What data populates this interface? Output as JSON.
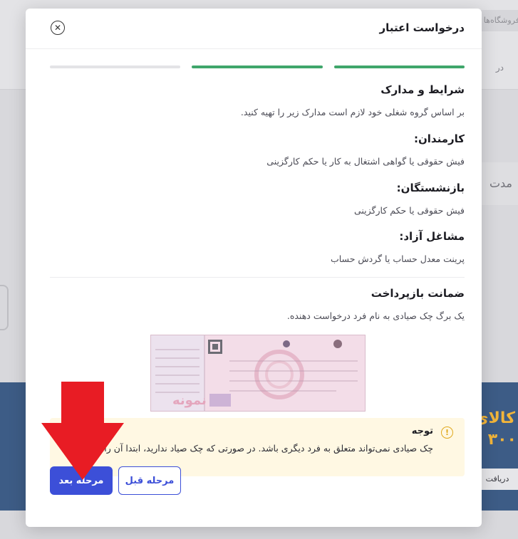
{
  "background": {
    "search_placeholder": "فروشگاه‌ها",
    "nav_text": "در",
    "card_text": "مدت",
    "banner_text": "کالای",
    "banner_number": "۳۰۰",
    "banner_button": "دریافت"
  },
  "modal": {
    "title": "درخواست اعتبار",
    "progress": {
      "steps_total": 3,
      "steps_completed": 2
    },
    "colors": {
      "progress_done": "#3fa66b",
      "progress_pending": "#e3e3e6",
      "accent": "#3c4fd8",
      "arrow": "#e81c24"
    },
    "sections": {
      "terms": {
        "heading": "شرایط و مدارک",
        "description": "بر اساس گروه شغلی خود لازم است مدارک زیر را تهیه کنید."
      },
      "employees": {
        "heading": "کارمندان:",
        "description": "فیش حقوقی یا گواهی اشتغال به کار یا حکم کارگزینی"
      },
      "retirees": {
        "heading": "بازنشستگان:",
        "description": "فیش حقوقی یا حکم کارگزینی"
      },
      "self_employed": {
        "heading": "مشاغل آزاد:",
        "description": "پرینت معدل حساب یا گردش حساب"
      },
      "guarantee": {
        "heading": "ضمانت بازپرداخت",
        "description": "یک برگ چک صیادی به نام فرد درخواست دهنده."
      }
    },
    "check_image": {
      "watermark": "نمونه"
    },
    "notice": {
      "icon": "warning-icon",
      "title": "توجه",
      "body": "چک صیادی نمی‌تواند متعلق به فرد دیگری باشد. در صورتی که چک صیاد ندارید، ابتدا آن را تهیه کنید."
    },
    "buttons": {
      "next": "مرحله بعد",
      "prev": "مرحله قبل"
    }
  }
}
